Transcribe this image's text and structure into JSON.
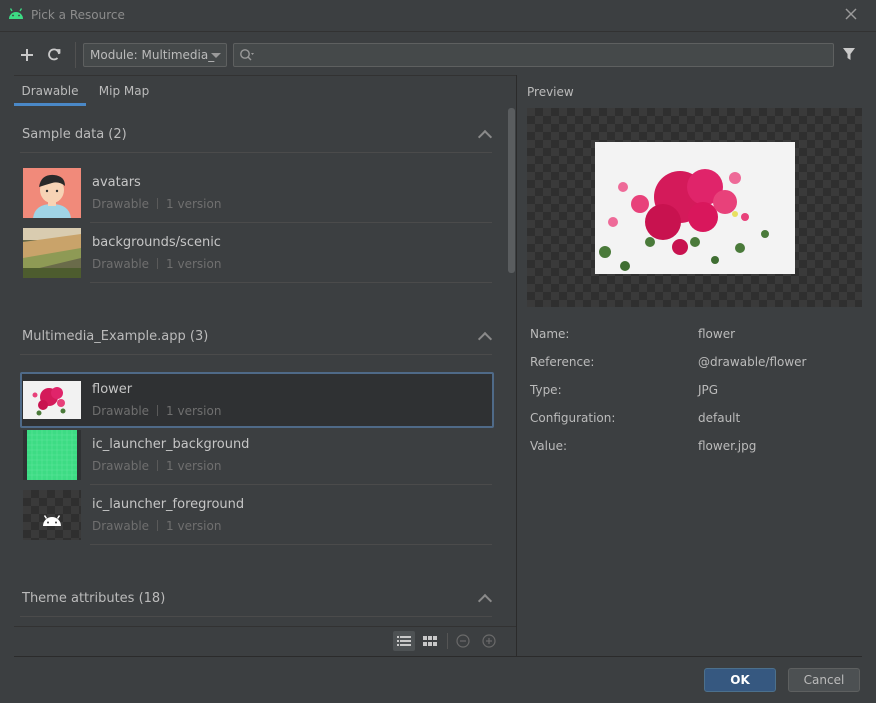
{
  "window": {
    "title": "Pick a Resource",
    "accent": "#3ddc84"
  },
  "toolbar": {
    "add_icon": "plus-icon",
    "refresh_icon": "refresh-icon",
    "module_value": "Module: Multimedia_",
    "search_placeholder": "",
    "search_value": "",
    "filter_icon": "filter-icon"
  },
  "tabs": [
    {
      "label": "Drawable",
      "active": true
    },
    {
      "label": "Mip Map",
      "active": false
    }
  ],
  "sections": [
    {
      "title": "Sample data (2)",
      "items": [
        {
          "name": "avatars",
          "type": "Drawable",
          "versions": "1 version",
          "thumb": "avatar"
        },
        {
          "name": "backgrounds/scenic",
          "type": "Drawable",
          "versions": "1 version",
          "thumb": "scenic"
        }
      ]
    },
    {
      "title": "Multimedia_Example.app (3)",
      "items": [
        {
          "name": "flower",
          "type": "Drawable",
          "versions": "1 version",
          "thumb": "flower",
          "selected": true
        },
        {
          "name": "ic_launcher_background",
          "type": "Drawable",
          "versions": "1 version",
          "thumb": "grid"
        },
        {
          "name": "ic_launcher_foreground",
          "type": "Drawable",
          "versions": "1 version",
          "thumb": "android"
        }
      ]
    },
    {
      "title": "Theme attributes (18)",
      "items": []
    }
  ],
  "view_controls": {
    "list_icon": "list-view-icon",
    "grid_icon": "grid-view-icon",
    "zoom_out_icon": "zoom-out-icon",
    "zoom_in_icon": "zoom-in-icon"
  },
  "preview": {
    "label": "Preview",
    "properties": [
      {
        "label": "Name:",
        "value": "flower"
      },
      {
        "label": "Reference:",
        "value": "@drawable/flower"
      },
      {
        "label": "Type:",
        "value": "JPG"
      },
      {
        "label": "Configuration:",
        "value": "default"
      },
      {
        "label": "Value:",
        "value": "flower.jpg"
      }
    ]
  },
  "buttons": {
    "ok": "OK",
    "cancel": "Cancel"
  }
}
